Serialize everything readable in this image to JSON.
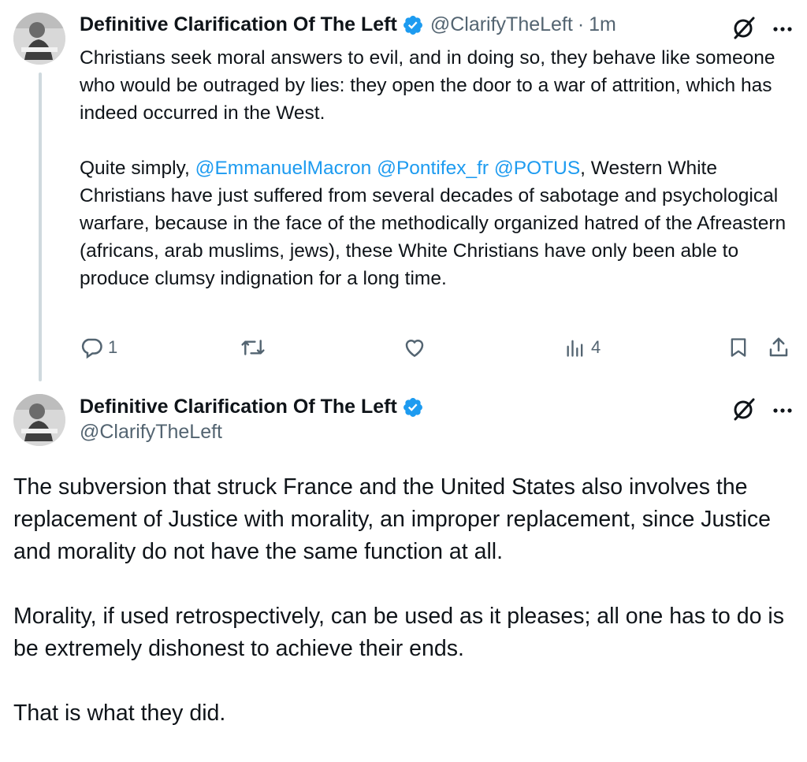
{
  "tweet1": {
    "author_name": "Definitive Clarification Of The Left",
    "handle": "@ClarifyTheLeft",
    "separator": "·",
    "time": "1m",
    "para1": "Christians seek moral answers to evil, and in doing so, they behave like someone who would be outraged by lies: they open the door to a war of attrition, which has indeed occurred in the West.",
    "para2_prefix": "Quite simply,",
    "mentions": [
      "@EmmanuelMacron",
      "@Pontifex_fr",
      "@POTUS"
    ],
    "para2_rest": ", Western White Christians have just suffered from several decades of sabotage and psychological warfare, because in the face of the methodically organized hatred of the Afreastern (africans, arab muslims, jews), these White Christians have only been able to produce clumsy indignation for a long time.",
    "actions": {
      "reply_count": "1",
      "retweet_count": "",
      "like_count": "",
      "views_count": "4"
    },
    "icons": [
      "grok-icon",
      "more-icon",
      "reply-icon",
      "retweet-icon",
      "like-icon",
      "views-icon",
      "bookmark-icon",
      "share-icon"
    ]
  },
  "tweet2": {
    "author_name": "Definitive Clarification Of The Left",
    "handle": "@ClarifyTheLeft",
    "paragraphs": [
      "The subversion that struck France and the United States also involves the replacement of Justice with morality, an improper replacement, since Justice and morality do not have the same function at all.",
      "Morality, if used retrospectively, can be used as it pleases; all one has to do is be extremely dishonest to achieve their ends.",
      "That is what they did."
    ],
    "icons": [
      "grok-icon",
      "more-icon"
    ]
  },
  "colors": {
    "accent": "#1d9bf0",
    "secondary_text": "#536471",
    "thread_line": "#cfd9de",
    "text": "#0f1419"
  }
}
